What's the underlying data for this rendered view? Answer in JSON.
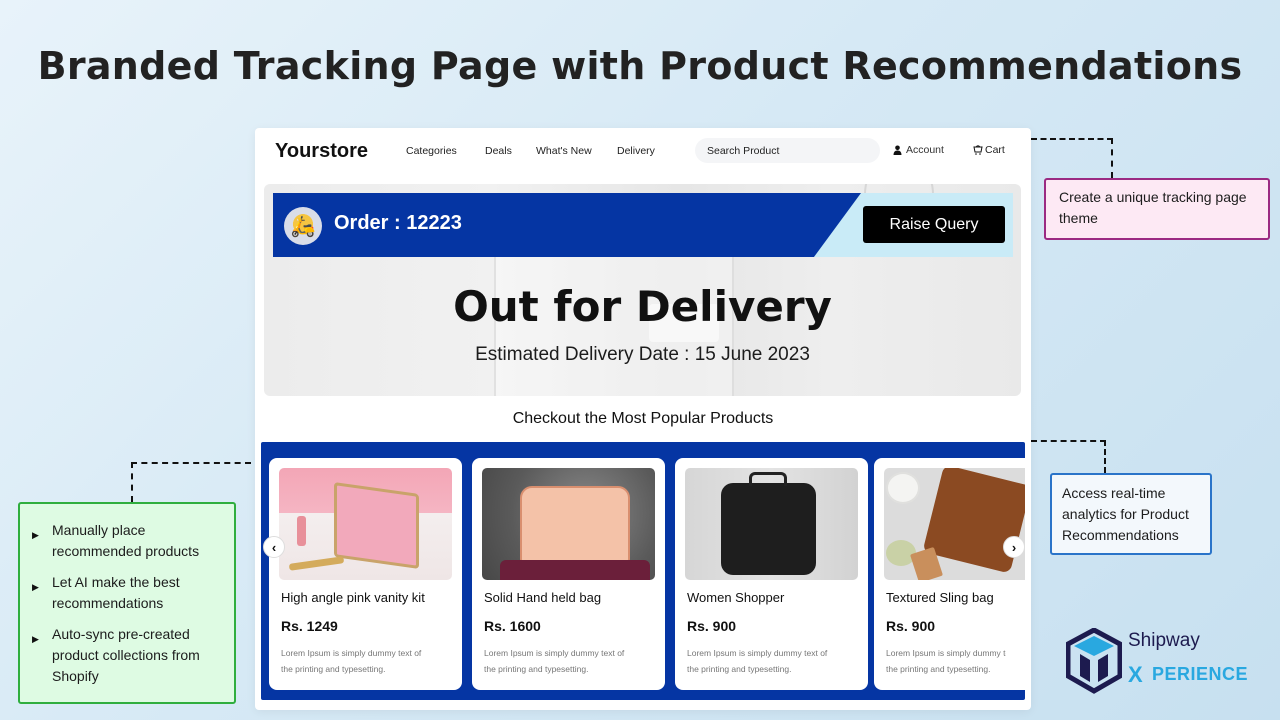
{
  "headline": "Branded Tracking Page with Product Recommendations",
  "store": {
    "logo": "Yourstore",
    "nav": [
      "Categories",
      "Deals",
      "What's New",
      "Delivery"
    ],
    "search_placeholder": "Search Product",
    "account_label": "Account",
    "account_icon": "user-icon",
    "cart_label": "Cart",
    "cart_icon": "cart-icon"
  },
  "tracking": {
    "order_label": "Order : 12223",
    "order_icon": "scooter-icon",
    "raise_query_label": "Raise Query",
    "status": "Out for Delivery",
    "eta": "Estimated Delivery Date : 15 June 2023",
    "brand_color": "#0535a3",
    "accent_light": "#c9ebf7"
  },
  "recommendations": {
    "title": "Checkout the Most Popular Products",
    "prev_icon": "chevron-left-icon",
    "next_icon": "chevron-right-icon",
    "products": [
      {
        "name": "High angle pink vanity kit",
        "price": "Rs. 1249",
        "desc_line1": "Lorem Ipsum is simply dummy text of",
        "desc_line2": "the printing and typesetting."
      },
      {
        "name": "Solid Hand held bag",
        "price": "Rs. 1600",
        "desc_line1": "Lorem Ipsum is simply dummy text of",
        "desc_line2": "the printing and typesetting."
      },
      {
        "name": "Women Shopper",
        "price": "Rs. 900",
        "desc_line1": "Lorem Ipsum is simply dummy text of",
        "desc_line2": "the printing and typesetting."
      },
      {
        "name": "Textured Sling bag",
        "price": "Rs. 900",
        "desc_line1": "Lorem Ipsum is simply dummy text of",
        "desc_line2": "the printing and typesetting."
      }
    ]
  },
  "callouts": {
    "theme": "Create a unique tracking page theme",
    "analytics": "Access real-time analytics for Product Recommendations",
    "features": [
      "Manually place recommended products",
      "Let AI make the best recommendations",
      "Auto-sync pre-created product collections from Shopify"
    ]
  },
  "brand": {
    "name": "Shipway",
    "sub": "PERIENCE",
    "x_glyph": "X"
  }
}
